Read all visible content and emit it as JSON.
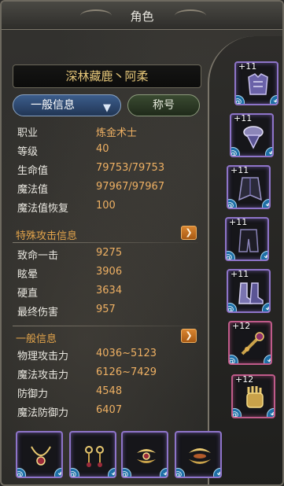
{
  "window": {
    "title": "角色"
  },
  "character": {
    "name": "深林藏鹿丶阿柔"
  },
  "tabs": {
    "dropdown_label": "一般信息",
    "title_button": "称号"
  },
  "basic_stats": [
    {
      "label": "职业",
      "value": "炼金术士"
    },
    {
      "label": "等级",
      "value": "40"
    },
    {
      "label": "生命值",
      "value": "79753/79753"
    },
    {
      "label": "魔法值",
      "value": "97967/97967"
    },
    {
      "label": "魔法值恢复",
      "value": "100"
    }
  ],
  "special_attack": {
    "heading": "特殊攻击信息",
    "stats": [
      {
        "label": "致命一击",
        "value": "9275"
      },
      {
        "label": "眩晕",
        "value": "3906"
      },
      {
        "label": "硬直",
        "value": "3634"
      },
      {
        "label": "最终伤害",
        "value": "957"
      }
    ]
  },
  "general_info": {
    "heading": "一般信息",
    "stats": [
      {
        "label": "物理攻击力",
        "value": "4036~5123"
      },
      {
        "label": "魔法攻击力",
        "value": "6126~7429"
      },
      {
        "label": "防御力",
        "value": "4548"
      },
      {
        "label": "魔法防御力",
        "value": "6407"
      }
    ]
  },
  "equipment_right": [
    {
      "enhance": "+11",
      "icon": "armor-chest-icon",
      "frame": "purple"
    },
    {
      "enhance": "+11",
      "icon": "armor-shoulder-icon",
      "frame": "purple"
    },
    {
      "enhance": "+11",
      "icon": "armor-cloak-icon",
      "frame": "purple"
    },
    {
      "enhance": "+11",
      "icon": "armor-pants-icon",
      "frame": "purple"
    },
    {
      "enhance": "+11",
      "icon": "armor-boots-icon",
      "frame": "purple"
    },
    {
      "enhance": "+12",
      "icon": "weapon-staff-icon",
      "frame": "red"
    },
    {
      "enhance": "+12",
      "icon": "glove-icon",
      "frame": "red"
    }
  ],
  "equipment_bottom": [
    {
      "icon": "necklace-icon"
    },
    {
      "icon": "earring-icon"
    },
    {
      "icon": "ring-icon"
    },
    {
      "icon": "bracelet-icon"
    }
  ],
  "badges": {
    "lock_glyph": "@",
    "swap_glyph": "⟲"
  },
  "colors": {
    "value_orange": "#eeb063",
    "section_orange": "#e3a44b",
    "name_gold": "#e7c87a",
    "slot_purple": "#8e74c9",
    "slot_red": "#c05b8a"
  }
}
